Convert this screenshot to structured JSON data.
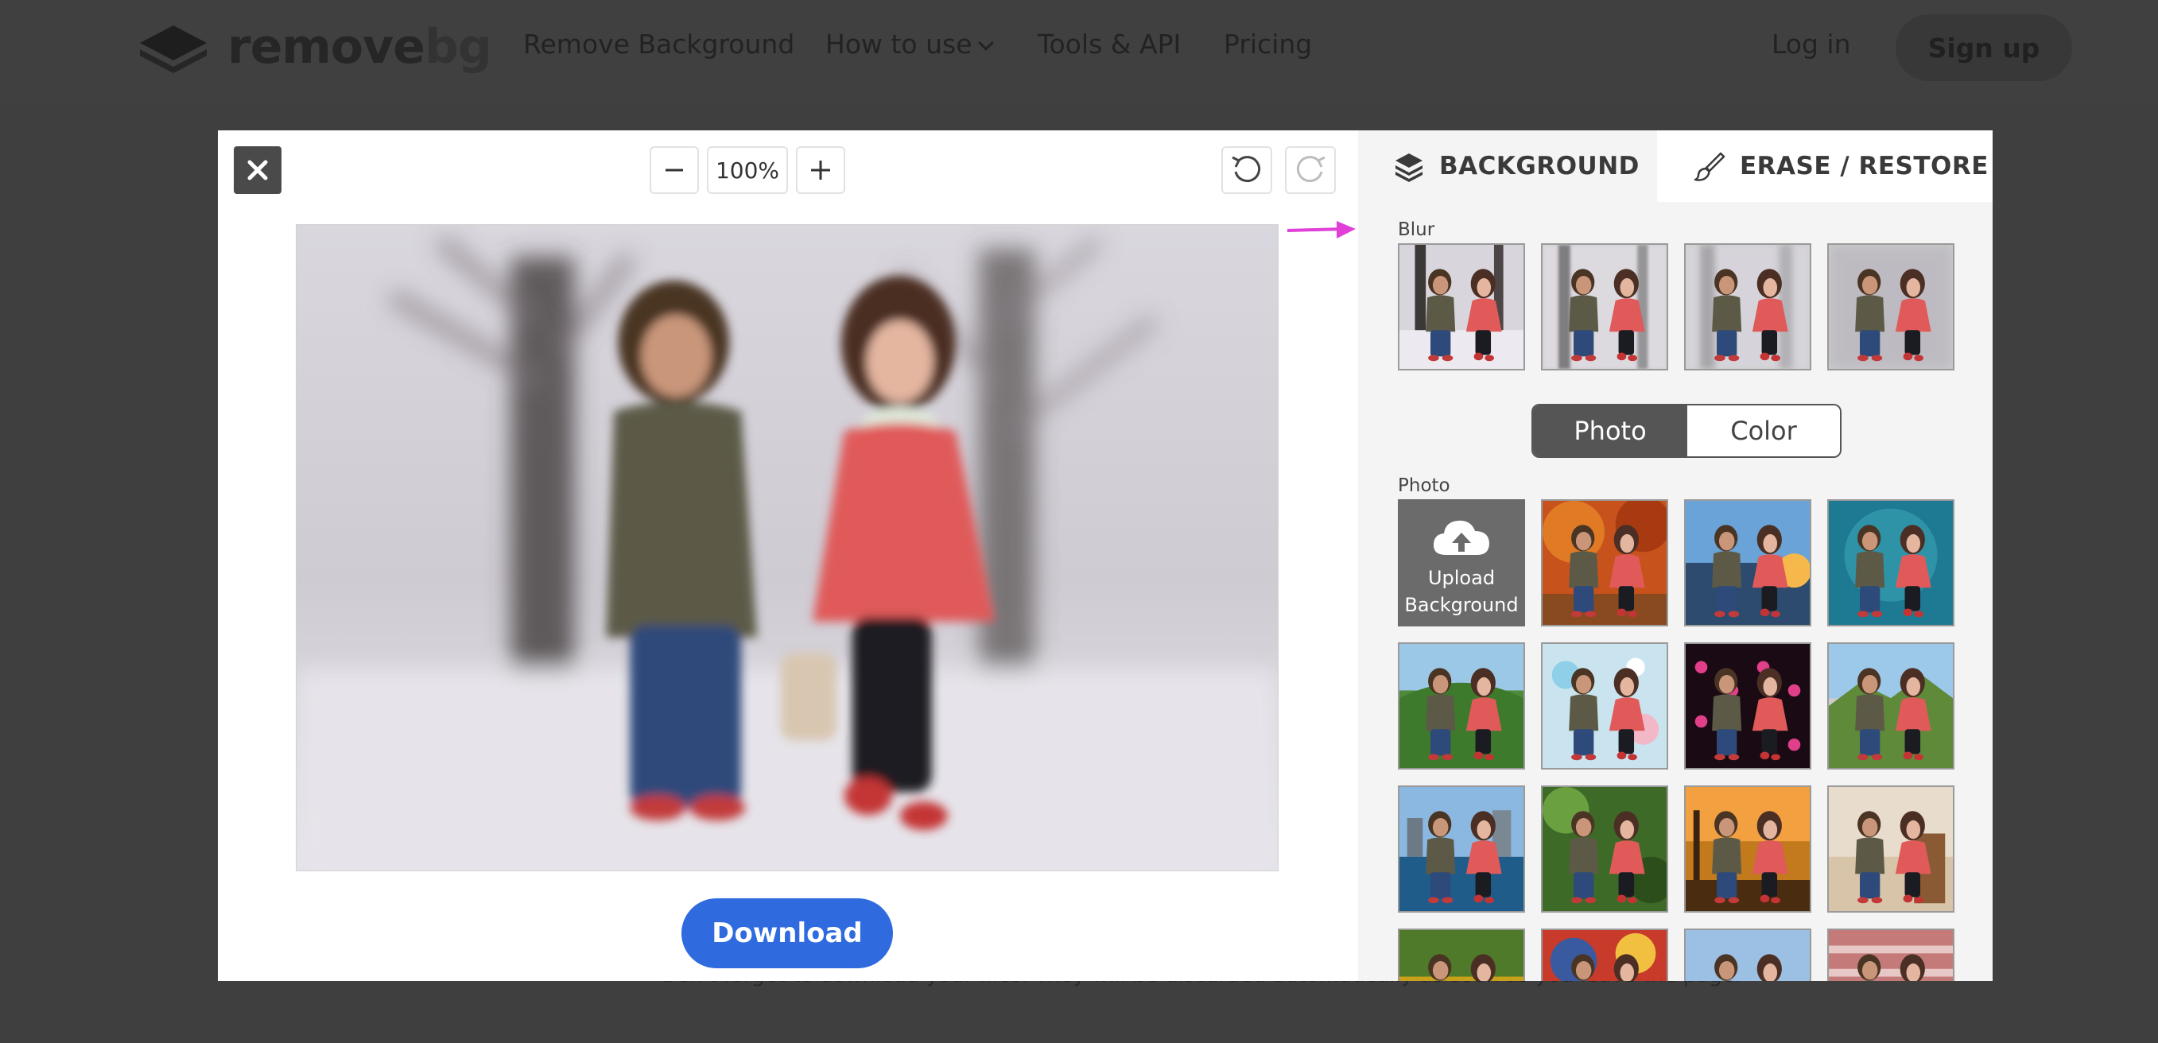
{
  "header": {
    "logo_word": "remove",
    "logo_suffix": "bg",
    "nav": [
      {
        "label": "Remove Background"
      },
      {
        "label": "How to use"
      },
      {
        "label": "Tools & API"
      },
      {
        "label": "Pricing"
      }
    ],
    "login_label": "Log in",
    "signup_label": "Sign up"
  },
  "page": {
    "bottom_hint": "Don't forget to download your files. They will be discarded automatically as soon as you leave the page."
  },
  "editor": {
    "zoom_level": "100%",
    "download_label": "Download",
    "accent_color": "#2f6bde",
    "annotation_arrow_color": "#e040d8"
  },
  "panel": {
    "tabs": [
      {
        "label": "BACKGROUND",
        "icon": "layers-icon",
        "active": true
      },
      {
        "label": "ERASE / RESTORE",
        "icon": "brush-icon",
        "active": false
      }
    ],
    "blur_label": "Blur",
    "blur_levels": [
      "blur-0",
      "blur-1",
      "blur-2",
      "blur-3"
    ],
    "toggle": {
      "photo_label": "Photo",
      "color_label": "Color",
      "selected": "Photo"
    },
    "photo_label": "Photo",
    "upload": {
      "line1": "Upload",
      "line2": "Background",
      "icon": "cloud-upload-icon"
    }
  }
}
